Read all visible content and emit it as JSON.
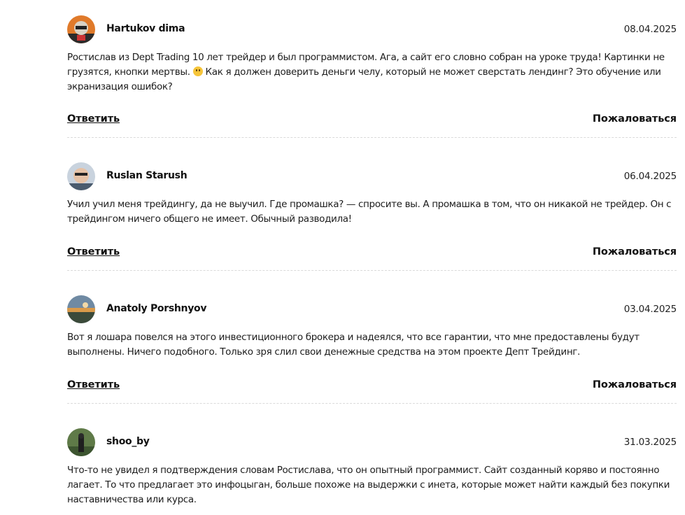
{
  "comments": [
    {
      "author": "Hartukov dima",
      "date": "08.04.2025",
      "text_part1": "Ростислав из Dept Trading 10 лет трейдер и был программистом. Ага, а сайт его словно собран на уроке труда! Картинки не грузятся, кнопки мертвы. ",
      "emoji_icon": "neutral-face-emoji-icon",
      "text_part2": " Как я должен доверить деньги челу, который не может сверстать лендинг? Это обучение или экранизация ошибок?",
      "reply_label": "Ответить",
      "report_label": "Пожаловаться"
    },
    {
      "author": "Ruslan Starush",
      "date": "06.04.2025",
      "text": "Учил учил меня трейдингу, да не выучил. Где промашка? — спросите вы. А промашка в том, что он никакой не трейдер. Он с трейдингом ничего общего не имеет. Обычный разводила!",
      "reply_label": "Ответить",
      "report_label": "Пожаловаться"
    },
    {
      "author": "Anatoly Porshnyov",
      "date": "03.04.2025",
      "text": "Вот я лошара повелся на этого инвестиционного брокера и надеялся, что все гарантии, что мне предоставлены будут выполнены. Ничего подобного. Только зря слил свои денежные средства на этом проекте Депт Трейдинг.",
      "reply_label": "Ответить",
      "report_label": "Пожаловаться"
    },
    {
      "author": "shoo_by",
      "date": "31.03.2025",
      "text": "Что-то не увидел я подтверждения словам Ростислава, что он опытный программист. Сайт созданный коряво и постоянно лагает. То что предлагает это инфоцыган, больше похоже на выдержки с инета, которые может найти каждый без покупки наставничества или курса."
    }
  ]
}
